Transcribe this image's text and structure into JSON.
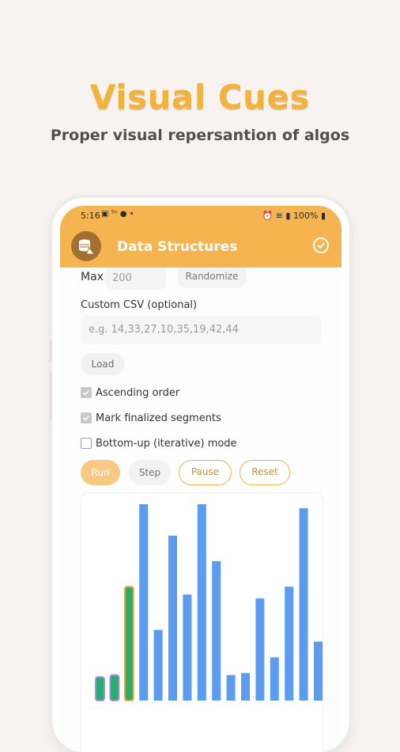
{
  "hero": {
    "title": "Visual Cues",
    "subtitle": "Proper visual repersantion of algos"
  },
  "status_bar": {
    "time": "5:16",
    "battery": "100%"
  },
  "app_bar": {
    "title": "Data Structures"
  },
  "controls": {
    "max_label": "Max",
    "max_value": "200",
    "randomize_label": "Randomize",
    "csv_label": "Custom CSV (optional)",
    "csv_placeholder": "e.g. 14,33,27,10,35,19,42,44",
    "load_label": "Load",
    "checkboxes": [
      {
        "label": "Ascending order",
        "checked": true
      },
      {
        "label": "Mark finalized segments",
        "checked": true
      },
      {
        "label": "Bottom-up (iterative) mode",
        "checked": false
      }
    ],
    "run_label": "Run",
    "step_label": "Step",
    "pause_label": "Pause",
    "reset_label": "Reset"
  },
  "colors": {
    "accent": "#f5b450",
    "bar_default": "#5b9cf1",
    "bar_active": "#27ae6b",
    "bar_finalized_outline": "#a98af0",
    "bar_active_outline": "#f2a93b"
  },
  "chart_data": {
    "type": "bar",
    "values": [
      12,
      13,
      58,
      100,
      36,
      84,
      54,
      100,
      71,
      13,
      14,
      52,
      22,
      58,
      98,
      30
    ],
    "states": [
      "finalized",
      "finalized",
      "active",
      "default",
      "default",
      "default",
      "default",
      "default",
      "default",
      "default",
      "default",
      "default",
      "default",
      "default",
      "default",
      "default"
    ],
    "ylim": [
      0,
      100
    ]
  }
}
